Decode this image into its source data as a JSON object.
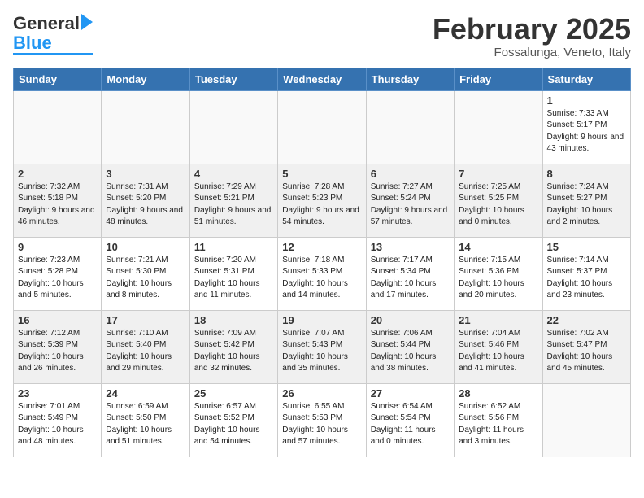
{
  "header": {
    "logo_general": "General",
    "logo_blue": "Blue",
    "month_title": "February 2025",
    "location": "Fossalunga, Veneto, Italy"
  },
  "days_of_week": [
    "Sunday",
    "Monday",
    "Tuesday",
    "Wednesday",
    "Thursday",
    "Friday",
    "Saturday"
  ],
  "weeks": [
    [
      {
        "day": "",
        "info": ""
      },
      {
        "day": "",
        "info": ""
      },
      {
        "day": "",
        "info": ""
      },
      {
        "day": "",
        "info": ""
      },
      {
        "day": "",
        "info": ""
      },
      {
        "day": "",
        "info": ""
      },
      {
        "day": "1",
        "info": "Sunrise: 7:33 AM\nSunset: 5:17 PM\nDaylight: 9 hours and 43 minutes."
      }
    ],
    [
      {
        "day": "2",
        "info": "Sunrise: 7:32 AM\nSunset: 5:18 PM\nDaylight: 9 hours and 46 minutes."
      },
      {
        "day": "3",
        "info": "Sunrise: 7:31 AM\nSunset: 5:20 PM\nDaylight: 9 hours and 48 minutes."
      },
      {
        "day": "4",
        "info": "Sunrise: 7:29 AM\nSunset: 5:21 PM\nDaylight: 9 hours and 51 minutes."
      },
      {
        "day": "5",
        "info": "Sunrise: 7:28 AM\nSunset: 5:23 PM\nDaylight: 9 hours and 54 minutes."
      },
      {
        "day": "6",
        "info": "Sunrise: 7:27 AM\nSunset: 5:24 PM\nDaylight: 9 hours and 57 minutes."
      },
      {
        "day": "7",
        "info": "Sunrise: 7:25 AM\nSunset: 5:25 PM\nDaylight: 10 hours and 0 minutes."
      },
      {
        "day": "8",
        "info": "Sunrise: 7:24 AM\nSunset: 5:27 PM\nDaylight: 10 hours and 2 minutes."
      }
    ],
    [
      {
        "day": "9",
        "info": "Sunrise: 7:23 AM\nSunset: 5:28 PM\nDaylight: 10 hours and 5 minutes."
      },
      {
        "day": "10",
        "info": "Sunrise: 7:21 AM\nSunset: 5:30 PM\nDaylight: 10 hours and 8 minutes."
      },
      {
        "day": "11",
        "info": "Sunrise: 7:20 AM\nSunset: 5:31 PM\nDaylight: 10 hours and 11 minutes."
      },
      {
        "day": "12",
        "info": "Sunrise: 7:18 AM\nSunset: 5:33 PM\nDaylight: 10 hours and 14 minutes."
      },
      {
        "day": "13",
        "info": "Sunrise: 7:17 AM\nSunset: 5:34 PM\nDaylight: 10 hours and 17 minutes."
      },
      {
        "day": "14",
        "info": "Sunrise: 7:15 AM\nSunset: 5:36 PM\nDaylight: 10 hours and 20 minutes."
      },
      {
        "day": "15",
        "info": "Sunrise: 7:14 AM\nSunset: 5:37 PM\nDaylight: 10 hours and 23 minutes."
      }
    ],
    [
      {
        "day": "16",
        "info": "Sunrise: 7:12 AM\nSunset: 5:39 PM\nDaylight: 10 hours and 26 minutes."
      },
      {
        "day": "17",
        "info": "Sunrise: 7:10 AM\nSunset: 5:40 PM\nDaylight: 10 hours and 29 minutes."
      },
      {
        "day": "18",
        "info": "Sunrise: 7:09 AM\nSunset: 5:42 PM\nDaylight: 10 hours and 32 minutes."
      },
      {
        "day": "19",
        "info": "Sunrise: 7:07 AM\nSunset: 5:43 PM\nDaylight: 10 hours and 35 minutes."
      },
      {
        "day": "20",
        "info": "Sunrise: 7:06 AM\nSunset: 5:44 PM\nDaylight: 10 hours and 38 minutes."
      },
      {
        "day": "21",
        "info": "Sunrise: 7:04 AM\nSunset: 5:46 PM\nDaylight: 10 hours and 41 minutes."
      },
      {
        "day": "22",
        "info": "Sunrise: 7:02 AM\nSunset: 5:47 PM\nDaylight: 10 hours and 45 minutes."
      }
    ],
    [
      {
        "day": "23",
        "info": "Sunrise: 7:01 AM\nSunset: 5:49 PM\nDaylight: 10 hours and 48 minutes."
      },
      {
        "day": "24",
        "info": "Sunrise: 6:59 AM\nSunset: 5:50 PM\nDaylight: 10 hours and 51 minutes."
      },
      {
        "day": "25",
        "info": "Sunrise: 6:57 AM\nSunset: 5:52 PM\nDaylight: 10 hours and 54 minutes."
      },
      {
        "day": "26",
        "info": "Sunrise: 6:55 AM\nSunset: 5:53 PM\nDaylight: 10 hours and 57 minutes."
      },
      {
        "day": "27",
        "info": "Sunrise: 6:54 AM\nSunset: 5:54 PM\nDaylight: 11 hours and 0 minutes."
      },
      {
        "day": "28",
        "info": "Sunrise: 6:52 AM\nSunset: 5:56 PM\nDaylight: 11 hours and 3 minutes."
      },
      {
        "day": "",
        "info": ""
      }
    ]
  ]
}
